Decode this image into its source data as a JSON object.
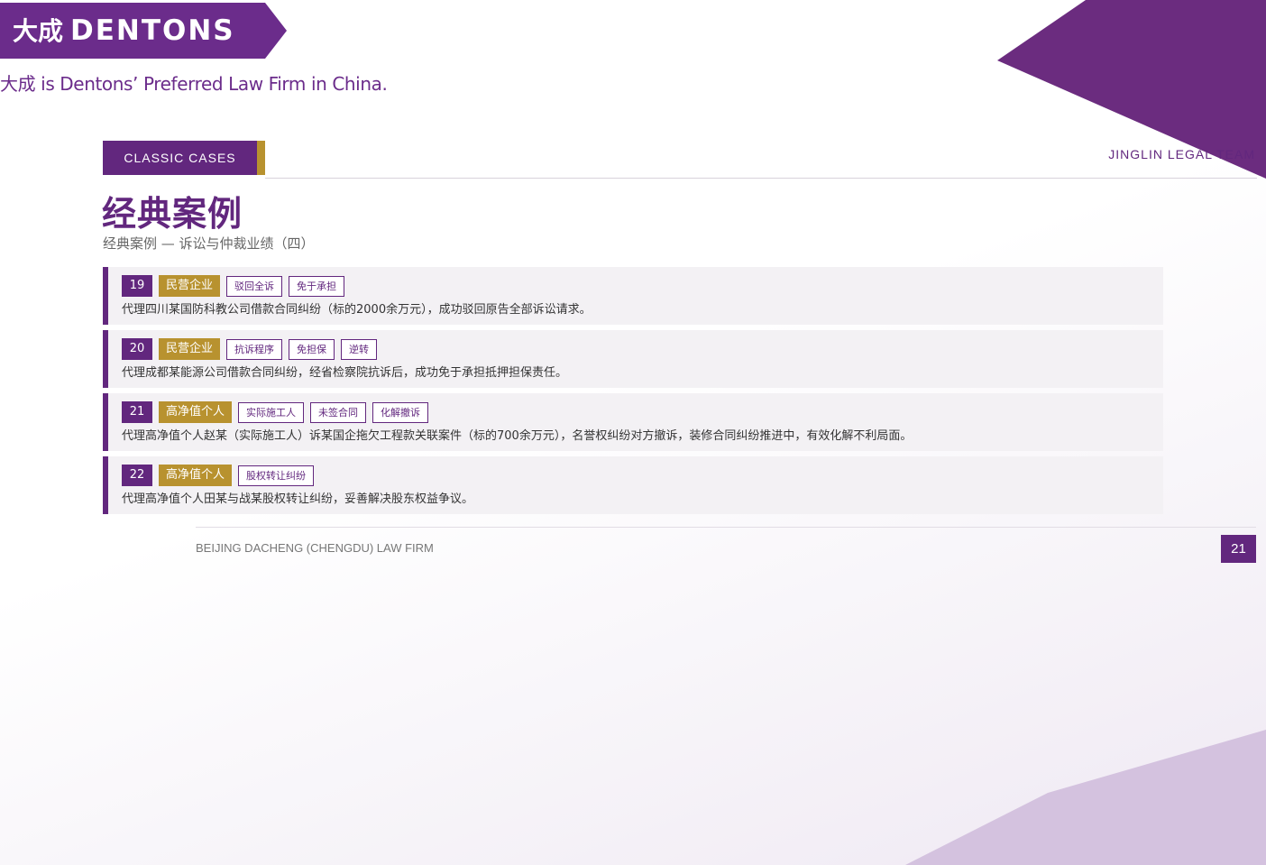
{
  "brand": {
    "logo_cn": "大成",
    "logo_en": "DENTONS",
    "tagline": "大成 is Dentons’ Preferred Law Firm in China.",
    "primary_color": "#62277e",
    "accent_color": "#b8922f"
  },
  "header": {
    "section_label": "CLASSIC CASES",
    "team_label": "JINGLIN LEGAL TEAM"
  },
  "page": {
    "title": "经典案例",
    "subtitle": "经典案例 — 诉讼与仲裁业绩（四）"
  },
  "cases": [
    {
      "number": "19",
      "category": "民营企业",
      "tags": [
        "驳回全诉",
        "免于承担"
      ],
      "description": "代理四川某国防科教公司借款合同纠纷（标的2000余万元），成功驳回原告全部诉讼请求。"
    },
    {
      "number": "20",
      "category": "民营企业",
      "tags": [
        "抗诉程序",
        "免担保",
        "逆转"
      ],
      "description": "代理成都某能源公司借款合同纠纷，经省检察院抗诉后，成功免于承担抵押担保责任。"
    },
    {
      "number": "21",
      "category": "高净值个人",
      "tags": [
        "实际施工人",
        "未签合同",
        "化解撤诉"
      ],
      "description": "代理高净值个人赵某（实际施工人）诉某国企拖欠工程款关联案件（标的700余万元），名誉权纠纷对方撤诉，装修合同纠纷推进中，有效化解不利局面。"
    },
    {
      "number": "22",
      "category": "高净值个人",
      "tags": [
        "股权转让纠纷"
      ],
      "description": "代理高净值个人田某与战某股权转让纠纷，妥善解决股东权益争议。"
    }
  ],
  "footer": {
    "firm_name": "BEIJING DACHENG (CHENGDU) LAW FIRM",
    "page_number": "21"
  }
}
